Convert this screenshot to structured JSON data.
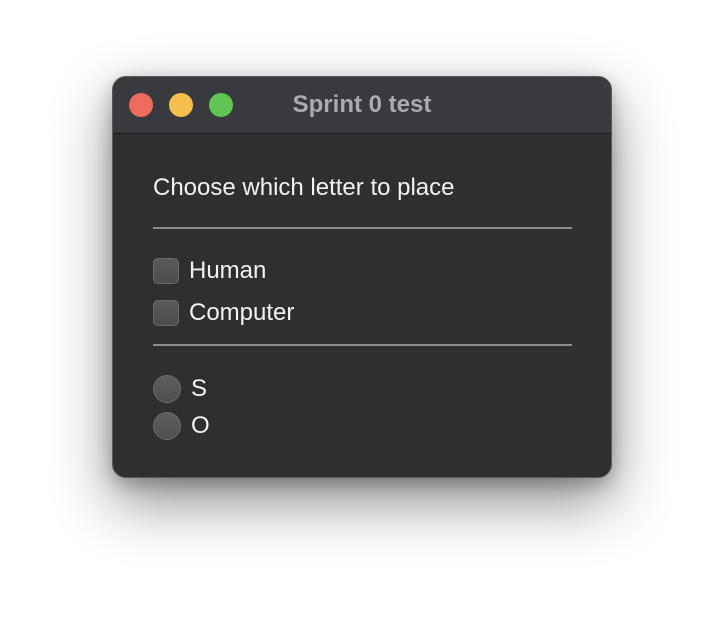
{
  "window": {
    "title": "Sprint 0 test"
  },
  "content": {
    "heading": "Choose which letter to place",
    "player_options": [
      {
        "label": "Human",
        "checked": false
      },
      {
        "label": "Computer",
        "checked": false
      }
    ],
    "letter_options": [
      {
        "label": "S",
        "selected": false
      },
      {
        "label": "O",
        "selected": false
      }
    ]
  },
  "colors": {
    "window_bg": "#2f2f2f",
    "titlebar_bg": "#383a3e",
    "close": "#ed6a5e",
    "minimize": "#f5bf4f",
    "maximize": "#61c554",
    "text": "#f2f2f2",
    "title_text": "#a9abaf"
  }
}
